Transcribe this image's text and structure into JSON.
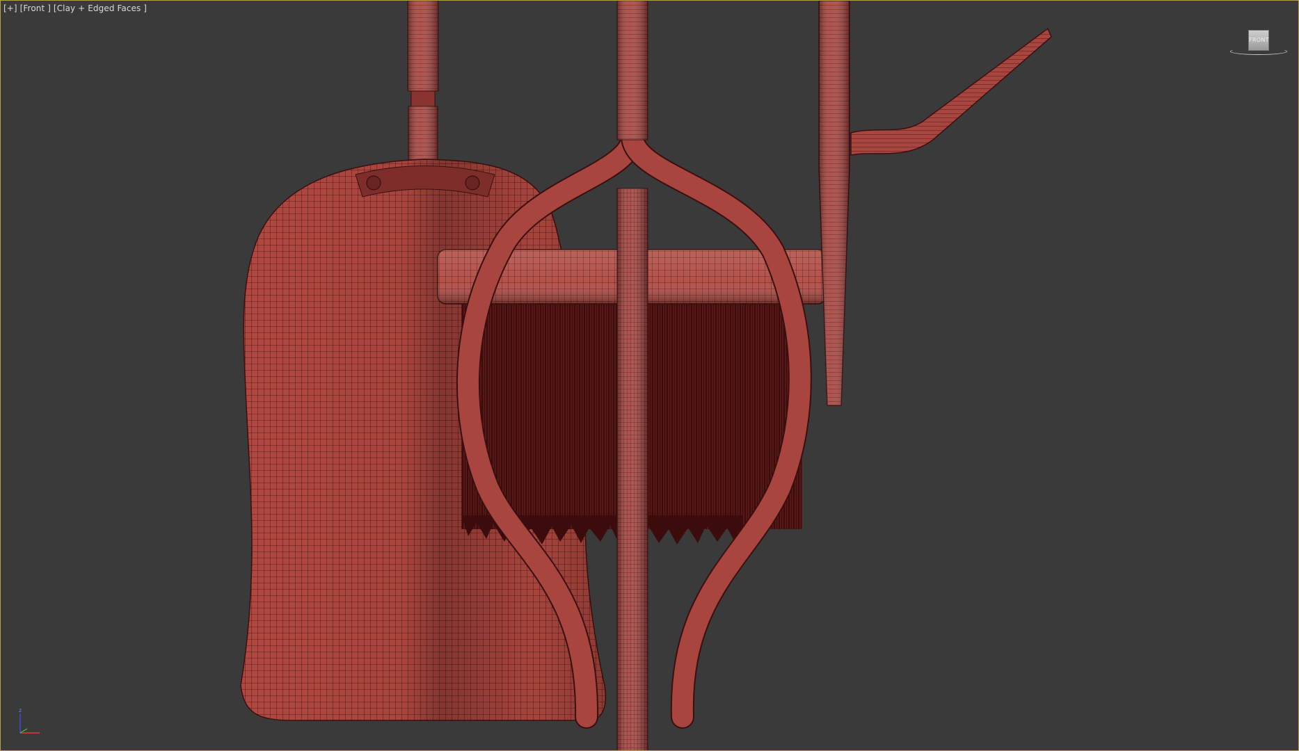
{
  "viewport": {
    "label_plus": "[+]",
    "label_view": "[Front ]",
    "label_shading": "[Clay + Edged Faces ]",
    "viewcube_face": "FRONT",
    "axis_z": "z",
    "border_color": "#b7a24a",
    "background_color": "#3a3a3a"
  },
  "scene": {
    "object_color": "#a0403a",
    "wire_color": "#3a0f0f",
    "objects": [
      "dustpan",
      "brush",
      "tongs",
      "poker"
    ]
  }
}
